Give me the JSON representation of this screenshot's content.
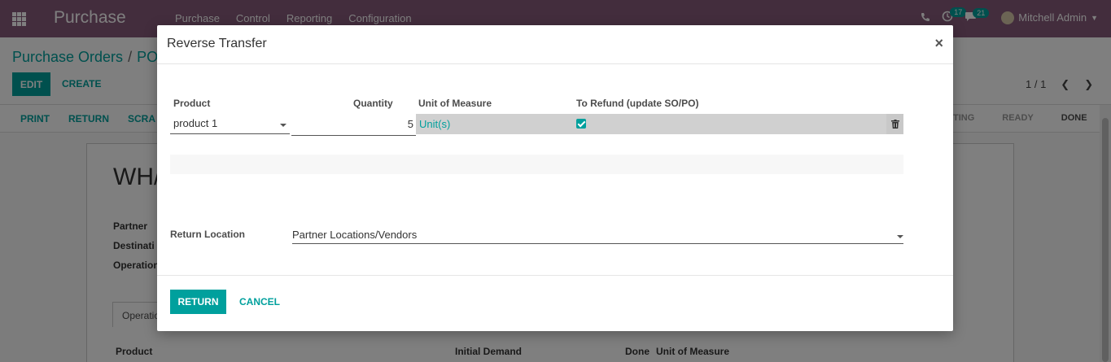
{
  "navbar": {
    "brand": "Purchase",
    "menu": [
      "Purchase",
      "Control",
      "Reporting",
      "Configuration"
    ],
    "activity_count": "17",
    "messages_count": "21",
    "user": "Mitchell Admin"
  },
  "control": {
    "breadcrumb_root": "Purchase Orders",
    "breadcrumb_sep": "/",
    "breadcrumb_current": "PO",
    "edit_label": "EDIT",
    "create_label": "CREATE",
    "pager": "1 / 1"
  },
  "statusbar": {
    "buttons": [
      "PRINT",
      "RETURN",
      "SCRA"
    ],
    "stages": [
      "AITING",
      "READY",
      "DONE"
    ],
    "active_stage": "DONE"
  },
  "sheet": {
    "title": "WH/",
    "labels": [
      "Partner",
      "Destinati",
      "Operation"
    ],
    "tab": "Operatio",
    "columns": [
      "Product",
      "Initial Demand",
      "Done",
      "Unit of Measure"
    ]
  },
  "modal": {
    "title": "Reverse Transfer",
    "close": "×",
    "headers": {
      "product": "Product",
      "quantity": "Quantity",
      "uom": "Unit of Measure",
      "refund": "To Refund (update SO/PO)"
    },
    "line": {
      "product": "product 1",
      "quantity": "5",
      "uom": "Unit(s)",
      "refund": true
    },
    "return_location_label": "Return Location",
    "return_location": "Partner Locations/Vendors",
    "return_button": "RETURN",
    "cancel_button": "CANCEL"
  },
  "colors": {
    "navbar": "#875a7b",
    "accent": "#00a09d"
  }
}
